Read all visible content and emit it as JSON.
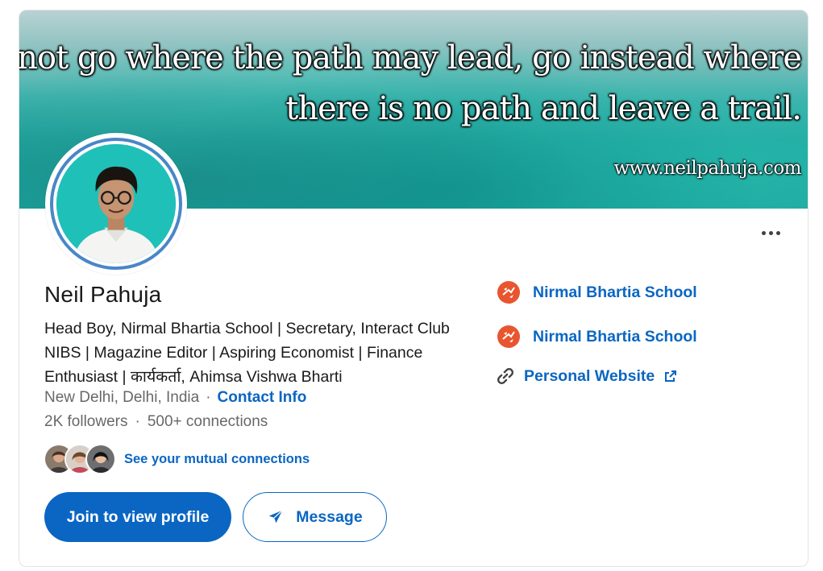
{
  "banner": {
    "quote_line1": "Do not go where the path may lead, go instead where",
    "quote_line2": "there is no path and leave a trail.",
    "url": "www.neilpahuja.com"
  },
  "profile": {
    "name": "Neil Pahuja",
    "headline_line1": "Head Boy, Nirmal Bhartia School | Secretary, Interact Club",
    "headline_line2": "NIBS | Magazine Editor | Aspiring Economist | Finance",
    "headline_line3": "Enthusiast | कार्यकर्ता, Ahimsa Vishwa Bharti",
    "location": "New Delhi, Delhi, India",
    "separator": "·",
    "contact_info": "Contact Info",
    "followers": "2K followers",
    "connections": "500+ connections",
    "mutual_connections": "See your mutual connections"
  },
  "actions": {
    "join_label": "Join to view profile",
    "message_label": "Message",
    "more_icon": "more-horizontal-icon"
  },
  "sidebar": {
    "items": [
      {
        "label": "Nirmal Bhartia School",
        "icon": "school-logo-icon"
      },
      {
        "label": "Nirmal Bhartia School",
        "icon": "school-logo-icon"
      },
      {
        "label": "Personal Website",
        "icon": "link-icon",
        "trailing_icon": "external-link-icon"
      }
    ]
  },
  "colors": {
    "accent": "#0a66c2",
    "school_logo": "#e8552f",
    "avatar_ring": "#4a86c8",
    "avatar_bg": "#1fc0b8"
  }
}
